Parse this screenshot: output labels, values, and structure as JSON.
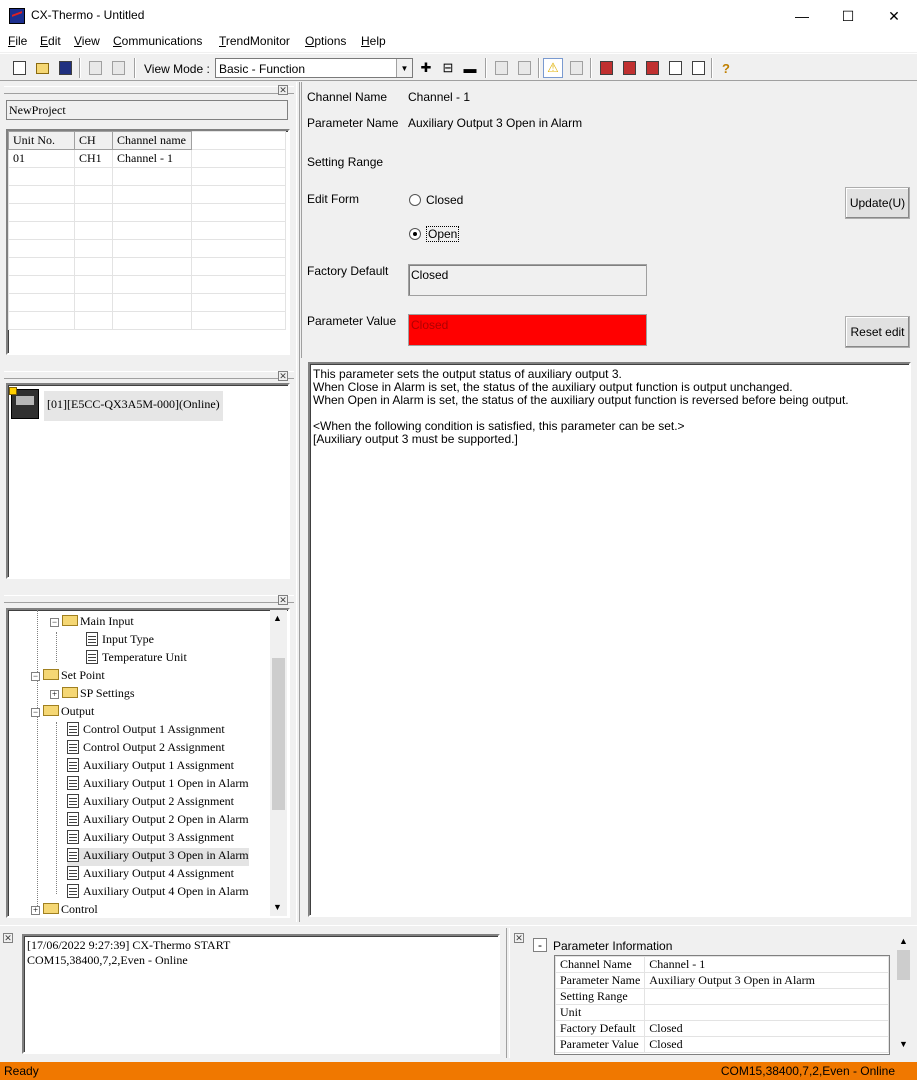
{
  "window": {
    "title": "CX-Thermo - Untitled",
    "minimize": "—",
    "maximize": "☐",
    "close": "✕"
  },
  "menu": [
    "File",
    "Edit",
    "View",
    "Communications",
    "TrendMonitor",
    "Options",
    "Help"
  ],
  "toolbar": {
    "view_mode_label": "View Mode :",
    "view_mode_value": "Basic - Function",
    "help_glyph": "?"
  },
  "project": {
    "name": "NewProject",
    "columns": [
      "Unit No.",
      "CH",
      "Channel name"
    ],
    "rows": [
      [
        "01",
        "CH1",
        "Channel - 1"
      ]
    ]
  },
  "device": {
    "label": "[01][E5CC-QX3A5M-000](Online)"
  },
  "tree": {
    "main_input": "Main Input",
    "input_type": "Input Type",
    "temperature_unit": "Temperature Unit",
    "set_point": "Set Point",
    "sp_settings": "SP Settings",
    "output": "Output",
    "items": [
      "Control Output 1 Assignment",
      "Control Output 2 Assignment",
      "Auxiliary Output 1 Assignment",
      "Auxiliary Output 1 Open in Alarm",
      "Auxiliary Output 2 Assignment",
      "Auxiliary Output 2 Open in Alarm",
      "Auxiliary Output 3 Assignment",
      "Auxiliary Output 3 Open in Alarm",
      "Auxiliary Output 4 Assignment",
      "Auxiliary Output 4 Open in Alarm"
    ],
    "control": "Control"
  },
  "detail": {
    "channel_name_label": "Channel Name",
    "channel_name_value": "Channel - 1",
    "parameter_name_label": "Parameter Name",
    "parameter_name_value": "Auxiliary Output 3 Open in Alarm",
    "setting_range_label": "Setting Range",
    "edit_form_label": "Edit Form",
    "option_closed": "Closed",
    "option_open": "Open",
    "update_button": "Update(U)",
    "factory_default_label": "Factory Default",
    "factory_default_value": "Closed",
    "parameter_value_label": "Parameter Value",
    "parameter_value_value": "Closed",
    "parameter_value_color": "#ff0000",
    "reset_button": "Reset edit"
  },
  "description": {
    "line1": "This parameter sets the output status of auxiliary output 3.",
    "line2": "When Close in Alarm is set, the status of the auxiliary output function is output unchanged.",
    "line3": "When Open in Alarm is set, the status of the auxiliary output function is reversed before being output.",
    "line4": "<When the following condition is satisfied, this parameter can be set.>",
    "line5": "[Auxiliary output 3 must be supported.]"
  },
  "log": {
    "line1": "[17/06/2022 9:27:39] CX-Thermo START",
    "line2": "COM15,38400,7,2,Even - Online"
  },
  "param_info": {
    "title": "Parameter Information",
    "collapse": "-",
    "rows": [
      [
        "Channel Name",
        "Channel - 1"
      ],
      [
        "Parameter Name",
        "Auxiliary Output 3 Open in Alarm"
      ],
      [
        "Setting Range",
        ""
      ],
      [
        "Unit",
        ""
      ],
      [
        "Factory Default",
        "Closed"
      ],
      [
        "Parameter Value",
        "Closed"
      ]
    ]
  },
  "status": {
    "left": "Ready",
    "right": "COM15,38400,7,2,Even - Online",
    "color": "#f07800"
  }
}
